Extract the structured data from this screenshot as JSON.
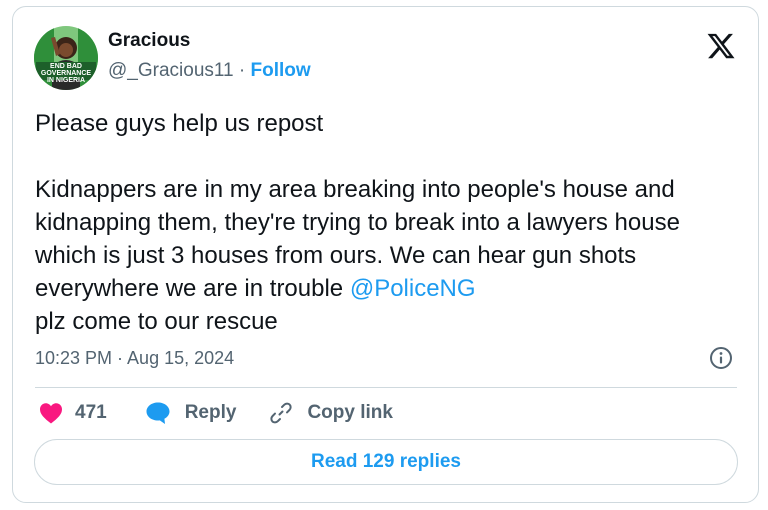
{
  "author": {
    "name": "Gracious",
    "handle": "@_Gracious11",
    "separator": "·",
    "follow_label": "Follow",
    "avatar_text": "END BAD GOVERNANCE IN NIGERIA"
  },
  "tweet": {
    "line1": "Please guys help us repost",
    "text": "Kidnappers are in my area breaking into people's house and kidnapping them, they're trying to break into a lawyers house which is just 3 houses from ours. We can hear gun shots everywhere we are in trouble ",
    "mention": "@PoliceNG",
    "text_end": "plz come to our rescue"
  },
  "meta": {
    "timestamp": "10:23 PM · Aug 15, 2024"
  },
  "actions": {
    "like_count": "471",
    "reply_label": "Reply",
    "copy_label": "Copy link"
  },
  "replies_button": "Read 129 replies",
  "icons": {
    "brand": "x-logo-icon",
    "like": "heart-icon",
    "reply": "speech-bubble-icon",
    "copy": "link-icon",
    "info": "info-icon"
  },
  "colors": {
    "accent": "#1d9bf0",
    "like": "#f91880",
    "text": "#0f1419",
    "secondary": "#536471",
    "border": "#cfd9de"
  }
}
